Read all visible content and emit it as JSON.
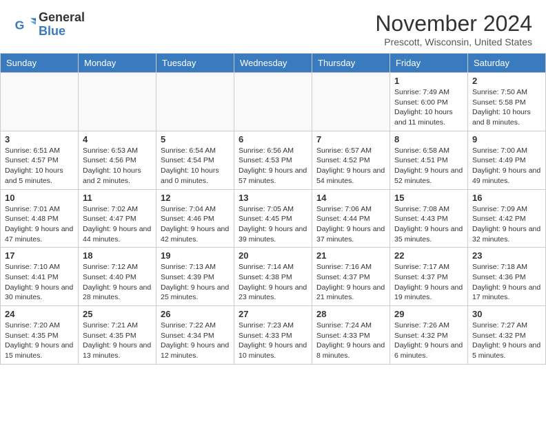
{
  "header": {
    "logo_general": "General",
    "logo_blue": "Blue",
    "month_title": "November 2024",
    "location": "Prescott, Wisconsin, United States"
  },
  "weekdays": [
    "Sunday",
    "Monday",
    "Tuesday",
    "Wednesday",
    "Thursday",
    "Friday",
    "Saturday"
  ],
  "weeks": [
    [
      {
        "day": "",
        "info": ""
      },
      {
        "day": "",
        "info": ""
      },
      {
        "day": "",
        "info": ""
      },
      {
        "day": "",
        "info": ""
      },
      {
        "day": "",
        "info": ""
      },
      {
        "day": "1",
        "info": "Sunrise: 7:49 AM\nSunset: 6:00 PM\nDaylight: 10 hours and 11 minutes."
      },
      {
        "day": "2",
        "info": "Sunrise: 7:50 AM\nSunset: 5:58 PM\nDaylight: 10 hours and 8 minutes."
      }
    ],
    [
      {
        "day": "3",
        "info": "Sunrise: 6:51 AM\nSunset: 4:57 PM\nDaylight: 10 hours and 5 minutes."
      },
      {
        "day": "4",
        "info": "Sunrise: 6:53 AM\nSunset: 4:56 PM\nDaylight: 10 hours and 2 minutes."
      },
      {
        "day": "5",
        "info": "Sunrise: 6:54 AM\nSunset: 4:54 PM\nDaylight: 10 hours and 0 minutes."
      },
      {
        "day": "6",
        "info": "Sunrise: 6:56 AM\nSunset: 4:53 PM\nDaylight: 9 hours and 57 minutes."
      },
      {
        "day": "7",
        "info": "Sunrise: 6:57 AM\nSunset: 4:52 PM\nDaylight: 9 hours and 54 minutes."
      },
      {
        "day": "8",
        "info": "Sunrise: 6:58 AM\nSunset: 4:51 PM\nDaylight: 9 hours and 52 minutes."
      },
      {
        "day": "9",
        "info": "Sunrise: 7:00 AM\nSunset: 4:49 PM\nDaylight: 9 hours and 49 minutes."
      }
    ],
    [
      {
        "day": "10",
        "info": "Sunrise: 7:01 AM\nSunset: 4:48 PM\nDaylight: 9 hours and 47 minutes."
      },
      {
        "day": "11",
        "info": "Sunrise: 7:02 AM\nSunset: 4:47 PM\nDaylight: 9 hours and 44 minutes."
      },
      {
        "day": "12",
        "info": "Sunrise: 7:04 AM\nSunset: 4:46 PM\nDaylight: 9 hours and 42 minutes."
      },
      {
        "day": "13",
        "info": "Sunrise: 7:05 AM\nSunset: 4:45 PM\nDaylight: 9 hours and 39 minutes."
      },
      {
        "day": "14",
        "info": "Sunrise: 7:06 AM\nSunset: 4:44 PM\nDaylight: 9 hours and 37 minutes."
      },
      {
        "day": "15",
        "info": "Sunrise: 7:08 AM\nSunset: 4:43 PM\nDaylight: 9 hours and 35 minutes."
      },
      {
        "day": "16",
        "info": "Sunrise: 7:09 AM\nSunset: 4:42 PM\nDaylight: 9 hours and 32 minutes."
      }
    ],
    [
      {
        "day": "17",
        "info": "Sunrise: 7:10 AM\nSunset: 4:41 PM\nDaylight: 9 hours and 30 minutes."
      },
      {
        "day": "18",
        "info": "Sunrise: 7:12 AM\nSunset: 4:40 PM\nDaylight: 9 hours and 28 minutes."
      },
      {
        "day": "19",
        "info": "Sunrise: 7:13 AM\nSunset: 4:39 PM\nDaylight: 9 hours and 25 minutes."
      },
      {
        "day": "20",
        "info": "Sunrise: 7:14 AM\nSunset: 4:38 PM\nDaylight: 9 hours and 23 minutes."
      },
      {
        "day": "21",
        "info": "Sunrise: 7:16 AM\nSunset: 4:37 PM\nDaylight: 9 hours and 21 minutes."
      },
      {
        "day": "22",
        "info": "Sunrise: 7:17 AM\nSunset: 4:37 PM\nDaylight: 9 hours and 19 minutes."
      },
      {
        "day": "23",
        "info": "Sunrise: 7:18 AM\nSunset: 4:36 PM\nDaylight: 9 hours and 17 minutes."
      }
    ],
    [
      {
        "day": "24",
        "info": "Sunrise: 7:20 AM\nSunset: 4:35 PM\nDaylight: 9 hours and 15 minutes."
      },
      {
        "day": "25",
        "info": "Sunrise: 7:21 AM\nSunset: 4:35 PM\nDaylight: 9 hours and 13 minutes."
      },
      {
        "day": "26",
        "info": "Sunrise: 7:22 AM\nSunset: 4:34 PM\nDaylight: 9 hours and 12 minutes."
      },
      {
        "day": "27",
        "info": "Sunrise: 7:23 AM\nSunset: 4:33 PM\nDaylight: 9 hours and 10 minutes."
      },
      {
        "day": "28",
        "info": "Sunrise: 7:24 AM\nSunset: 4:33 PM\nDaylight: 9 hours and 8 minutes."
      },
      {
        "day": "29",
        "info": "Sunrise: 7:26 AM\nSunset: 4:32 PM\nDaylight: 9 hours and 6 minutes."
      },
      {
        "day": "30",
        "info": "Sunrise: 7:27 AM\nSunset: 4:32 PM\nDaylight: 9 hours and 5 minutes."
      }
    ]
  ]
}
